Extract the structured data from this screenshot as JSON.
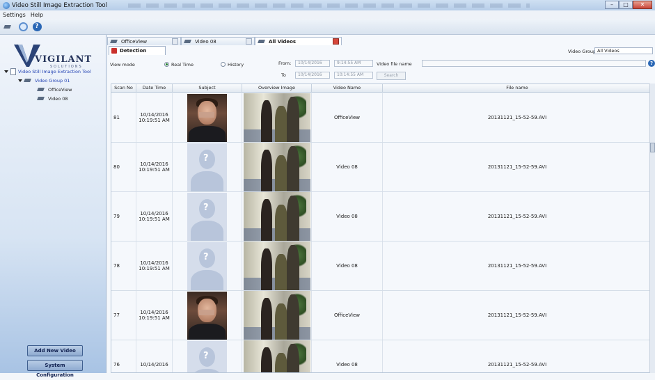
{
  "window": {
    "title": "Video Still Image Extraction Tool"
  },
  "menu": [
    "Settings",
    "Help"
  ],
  "logo": {
    "text": "VIGILANT",
    "sub": "SOLUTIONS"
  },
  "tree": {
    "root": "Video Still Image Extraction Tool",
    "group": "Video Group 01",
    "items": [
      "OfficeView",
      "Video 08"
    ]
  },
  "sidebar_buttons": {
    "add": "Add New Video",
    "config": "System Configuration"
  },
  "tabs": [
    "OfficeView",
    "Video 08",
    "All Videos"
  ],
  "subtab": "Detection",
  "filters": {
    "view_mode_label": "View mode",
    "real_time": "Real Time",
    "history": "History",
    "from_label": "From:",
    "to_label": "To",
    "from_date": "10/14/2016",
    "from_time": "9:14:55 AM",
    "to_date": "10/14/2016",
    "to_time": "10:14:55 AM",
    "file_label": "Video file name",
    "search": "Search",
    "group_label": "Video Group:",
    "group_value": "All Videos"
  },
  "columns": [
    "Scan No",
    "Date Time",
    "Subject",
    "Overview Image",
    "Video Name",
    "File name"
  ],
  "rows": [
    {
      "scan": "81",
      "date": "10/14/2016",
      "time": "10:19:51 AM",
      "subject": "real",
      "video": "OfficeView",
      "file": "20131121_15-52-59.AVI"
    },
    {
      "scan": "80",
      "date": "10/14/2016",
      "time": "10:19:51 AM",
      "subject": "unknown",
      "video": "Video 08",
      "file": "20131121_15-52-59.AVI"
    },
    {
      "scan": "79",
      "date": "10/14/2016",
      "time": "10:19:51 AM",
      "subject": "unknown",
      "video": "Video 08",
      "file": "20131121_15-52-59.AVI"
    },
    {
      "scan": "78",
      "date": "10/14/2016",
      "time": "10:19:51 AM",
      "subject": "unknown",
      "video": "Video 08",
      "file": "20131121_15-52-59.AVI"
    },
    {
      "scan": "77",
      "date": "10/14/2016",
      "time": "10:19:51 AM",
      "subject": "real",
      "video": "OfficeView",
      "file": "20131121_15-52-59.AVI"
    },
    {
      "scan": "76",
      "date": "10/14/2016",
      "time": "",
      "subject": "unknown",
      "video": "Video 08",
      "file": "20131121_15-52-59.AVI"
    }
  ]
}
